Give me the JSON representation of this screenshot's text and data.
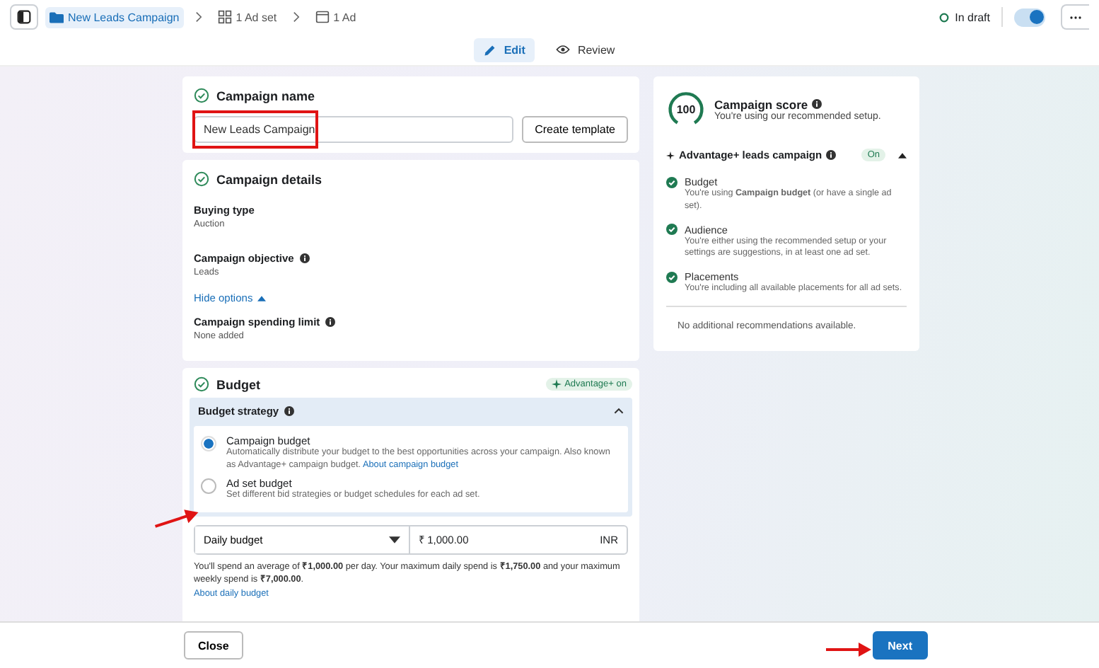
{
  "topbar": {
    "breadcrumbs": [
      {
        "kind": "campaign",
        "label": "New Leads Campaign",
        "selected": true
      },
      {
        "kind": "adset",
        "label": "1 Ad set",
        "selected": false
      },
      {
        "kind": "ad",
        "label": "1 Ad",
        "selected": false
      }
    ],
    "status": "In draft",
    "toggle_on": true
  },
  "mode_tabs": [
    {
      "kind": "edit",
      "label": "Edit",
      "selected": true
    },
    {
      "kind": "review",
      "label": "Review",
      "selected": false
    }
  ],
  "campaign_name": {
    "title": "Campaign name",
    "value": "New Leads Campaign",
    "button": "Create template"
  },
  "campaign_details": {
    "title": "Campaign details",
    "items": [
      {
        "kind": "field",
        "label": "Buying type",
        "value": "Auction",
        "info": false
      },
      {
        "kind": "field",
        "label": "Campaign objective",
        "value": "Leads",
        "info": true
      },
      {
        "kind": "link",
        "label": "Hide options"
      },
      {
        "kind": "field",
        "label": "Campaign spending limit",
        "value": "None added",
        "info": true
      }
    ]
  },
  "budget": {
    "title": "Budget",
    "badge": "Advantage+ on",
    "strategy": {
      "title": "Budget strategy",
      "expanded": true,
      "options": [
        {
          "label": "Campaign budget",
          "description": "Automatically distribute your budget to the best opportunities across your campaign. Also known as Advantage+ campaign budget.",
          "link": "About campaign budget",
          "selected": true
        },
        {
          "label": "Ad set budget",
          "description": "Set different bid strategies or budget schedules for each ad set.",
          "selected": false
        }
      ]
    },
    "budget_type": "Daily budget",
    "amount": "₹ 1,000.00",
    "currency": "INR",
    "note": "You'll spend an average of **₹1,000.00** per day. Your maximum daily spend is **₹1,750.00** and your maximum weekly spend is **₹7,000.00**.",
    "note_link": "About daily budget"
  },
  "score": {
    "value": "100",
    "title": "Campaign score",
    "subtitle": "You're using our recommended setup.",
    "advantage": {
      "title": "Advantage+ leads campaign",
      "badge": "On",
      "expanded": true
    },
    "checks": [
      {
        "title": "Budget",
        "description": "You're using **Campaign budget** (or have a single ad set)."
      },
      {
        "title": "Audience",
        "description": "You're either using the recommended setup or your settings are suggestions, in at least one ad set."
      },
      {
        "title": "Placements",
        "description": "You're including all available placements for all ad sets."
      }
    ],
    "footer": "No additional recommendations available."
  },
  "footer": {
    "buttons": [
      {
        "kind": "secondary",
        "label": "Close"
      },
      {
        "kind": "primary",
        "label": "Next"
      }
    ]
  }
}
